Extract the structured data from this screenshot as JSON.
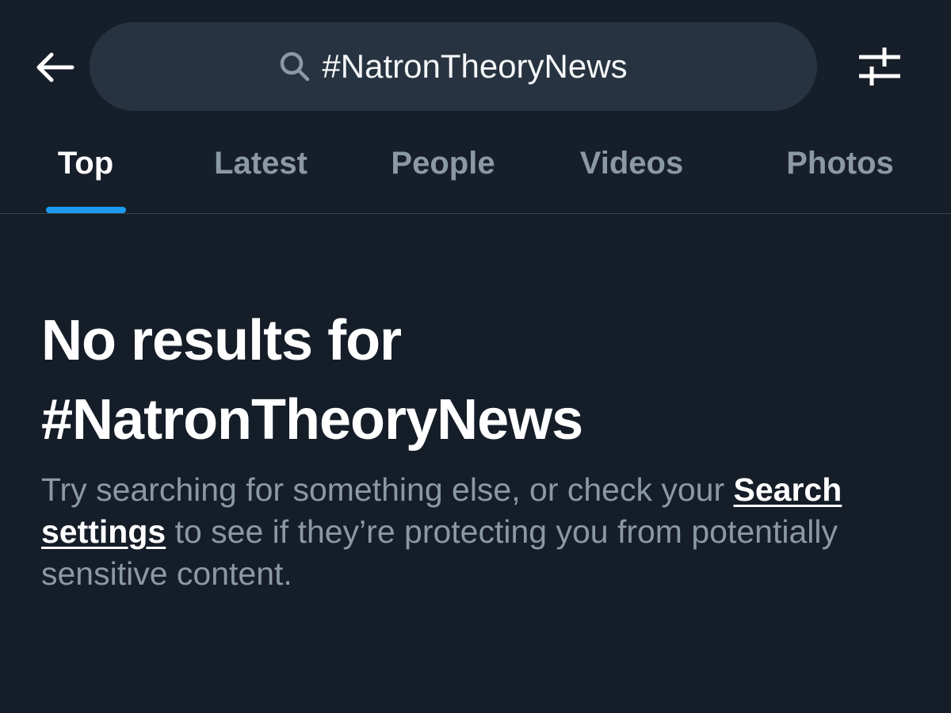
{
  "search": {
    "query": "#NatronTheoryNews"
  },
  "icons": {
    "back": "arrow-left-icon",
    "search": "search-icon",
    "filter": "sliders-icon"
  },
  "tabs": [
    {
      "label": "Top",
      "active": true
    },
    {
      "label": "Latest",
      "active": false
    },
    {
      "label": "People",
      "active": false
    },
    {
      "label": "Videos",
      "active": false
    },
    {
      "label": "Photos",
      "active": false
    }
  ],
  "empty_state": {
    "title_line1": "No results for",
    "title_line2": "#NatronTheoryNews",
    "body_before_link": "Try searching for something else, or check your ",
    "link_text": "Search settings",
    "body_after_link": " to see if they’re protecting you from potentially sensitive content."
  },
  "colors": {
    "background": "#151d28",
    "search_pill": "#273340",
    "accent": "#1d9bf0",
    "muted_text": "#8b98a5",
    "text": "#ffffff"
  }
}
